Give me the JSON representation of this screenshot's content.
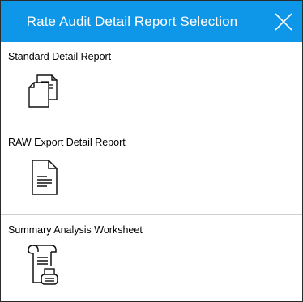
{
  "dialog": {
    "title": "Rate Audit Detail Report Selection",
    "close_icon": "close-icon",
    "header_color": "#0e96e8"
  },
  "options": [
    {
      "label": "Standard Detail Report",
      "icon": "documents-stack-icon"
    },
    {
      "label": "RAW Export Detail Report",
      "icon": "document-lines-icon"
    },
    {
      "label": "Summary Analysis Worksheet",
      "icon": "scroll-document-icon"
    }
  ]
}
